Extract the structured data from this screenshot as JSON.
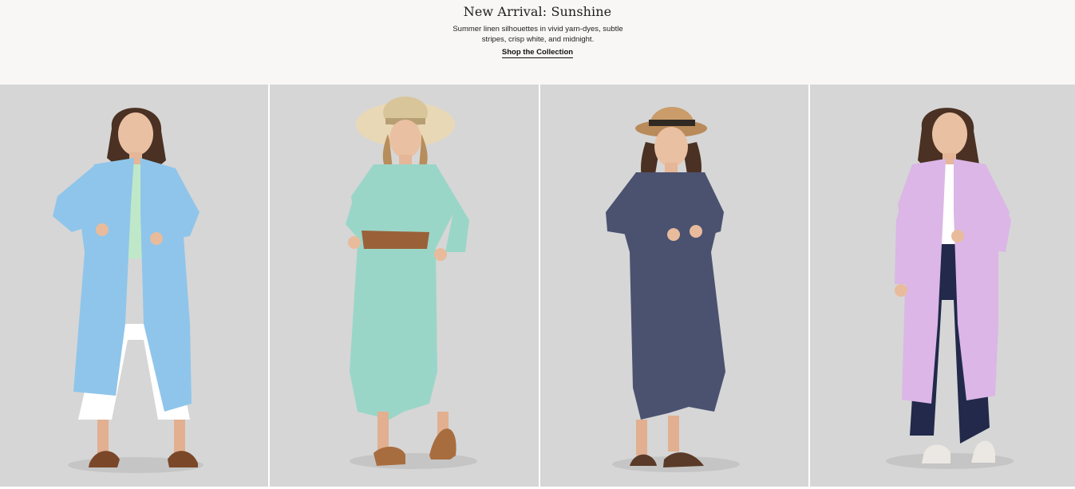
{
  "hero": {
    "title": "New Arrival: Sunshine",
    "description": "Summer linen silhouettes in vivid yarn-dyes, subtle stripes, crisp white, and midnight.",
    "cta_label": "Shop the Collection"
  },
  "products": [
    {
      "name": "model-blue-linen-shirt-dress",
      "color": "#8fc5ea",
      "accent": "#bfe8c9",
      "pants": "#ffffff",
      "hat": "none"
    },
    {
      "name": "model-mint-linen-shirt-dress",
      "color": "#9ad6c8",
      "accent": "#9a6139",
      "pants": "none",
      "hat": "#e8d8b6"
    },
    {
      "name": "model-navy-linen-shirt-dress",
      "color": "#4b5270",
      "accent": "#5a3a28",
      "pants": "none",
      "hat": "#b98a5a"
    },
    {
      "name": "model-lilac-linen-duster",
      "color": "#dbb6e6",
      "accent": "#ffffff",
      "pants": "#22294a",
      "hat": "none"
    }
  ]
}
